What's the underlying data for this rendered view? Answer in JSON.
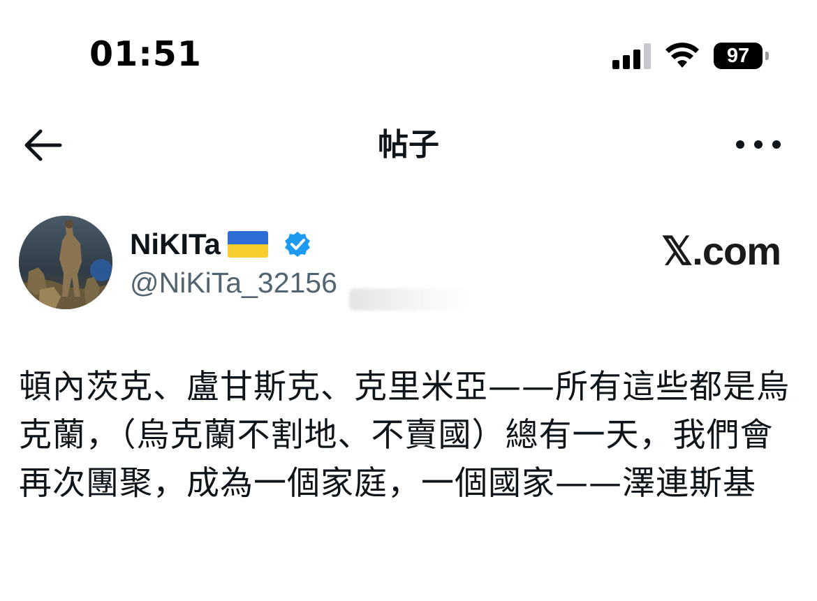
{
  "status_bar": {
    "time": "01:51",
    "battery": "97"
  },
  "nav": {
    "title": "帖子",
    "back_icon": "arrow-left-icon",
    "more_icon": "more-horizontal-icon"
  },
  "author": {
    "name": "NiKITa",
    "handle": "@NiKiTa_32156",
    "flag_icon": "ukraine-flag-icon",
    "verified_icon": "verified-badge-icon",
    "verified_color": "#1d9bf0"
  },
  "watermark": "𝕏.com",
  "tweet": {
    "text": "頓內茨克、盧甘斯克、克里米亞——所有這些都是烏克蘭，（烏克蘭不割地、不賣國）總有一天，我們會再次團聚，成為一個家庭，一個國家——澤連斯基"
  }
}
